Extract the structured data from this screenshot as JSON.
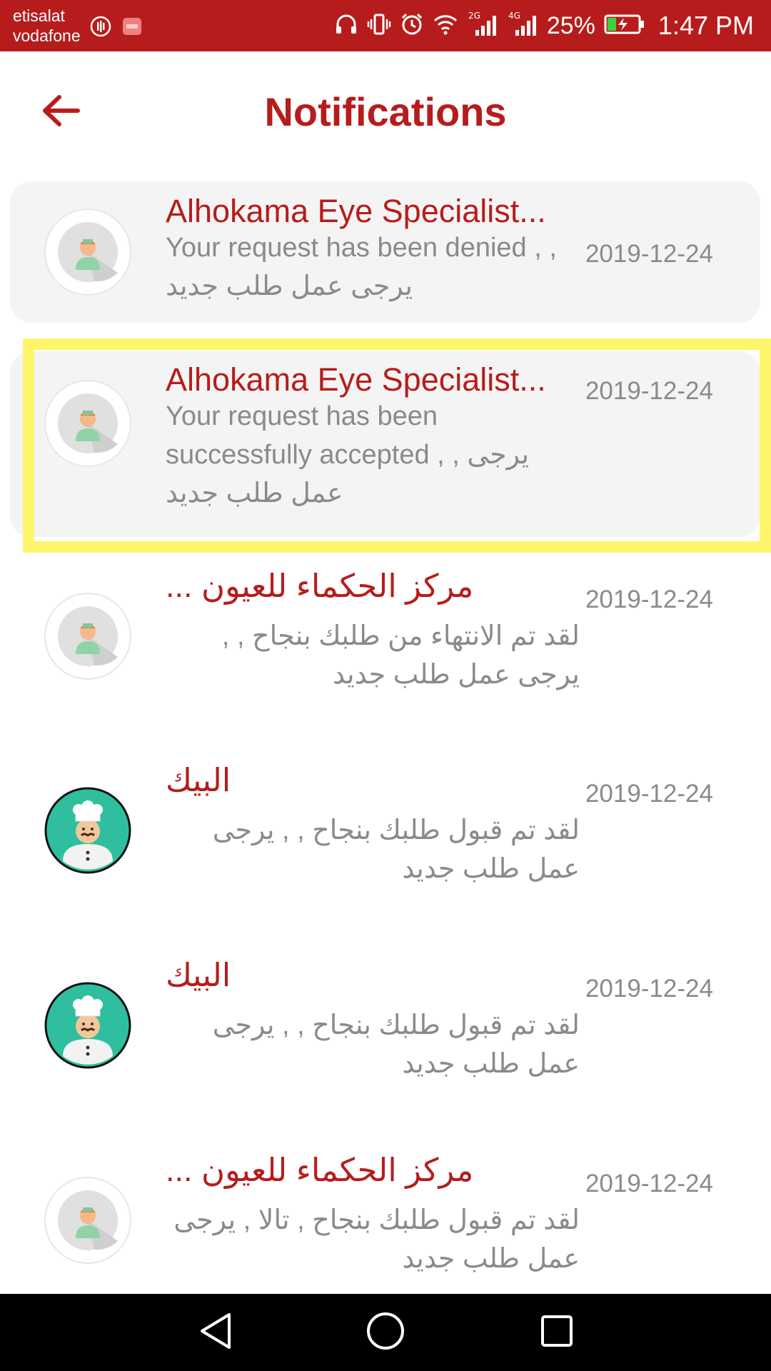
{
  "status_bar": {
    "carrier_1": "etisalat",
    "carrier_2": "vodafone",
    "network_1": "2G",
    "network_2": "4G",
    "battery": "25%",
    "time": "1:47 PM",
    "color": "#b71c1c"
  },
  "header": {
    "title": "Notifications",
    "back_icon": "arrow-left-icon"
  },
  "notifications": [
    {
      "title": "Alhokama Eye Specialist...",
      "body": "Your request has been denied , , يرجى عمل طلب جديد",
      "date": "2019-12-24",
      "avatar": "nurse-avatar-icon"
    },
    {
      "title": "Alhokama Eye Specialist...",
      "body": "Your request has been successfully accepted , , يرجى عمل طلب جديد",
      "date": "2019-12-24",
      "avatar": "nurse-avatar-icon"
    },
    {
      "title": "مركز الحكماء للعيون ...",
      "body": "لقد تم الانتهاء من طلبك بنجاح , , يرجى عمل طلب جديد",
      "date": "2019-12-24",
      "avatar": "nurse-avatar-icon"
    },
    {
      "title": "البيك",
      "body": "لقد تم قبول طلبك بنجاح , , يرجى عمل طلب جديد",
      "date": "2019-12-24",
      "avatar": "chef-avatar-icon"
    },
    {
      "title": "البيك",
      "body": "لقد تم قبول طلبك بنجاح , , يرجى عمل طلب جديد",
      "date": "2019-12-24",
      "avatar": "chef-avatar-icon"
    },
    {
      "title": "مركز الحكماء للعيون ...",
      "body": "لقد تم قبول طلبك بنجاح , تالا , يرجى عمل طلب جديد",
      "date": "2019-12-24",
      "avatar": "nurse-avatar-icon"
    }
  ],
  "colors": {
    "accent": "#b71c1c",
    "highlight": "#fff56b",
    "card_bg": "#f4f4f4",
    "chef_bg": "#2fbf9f"
  }
}
